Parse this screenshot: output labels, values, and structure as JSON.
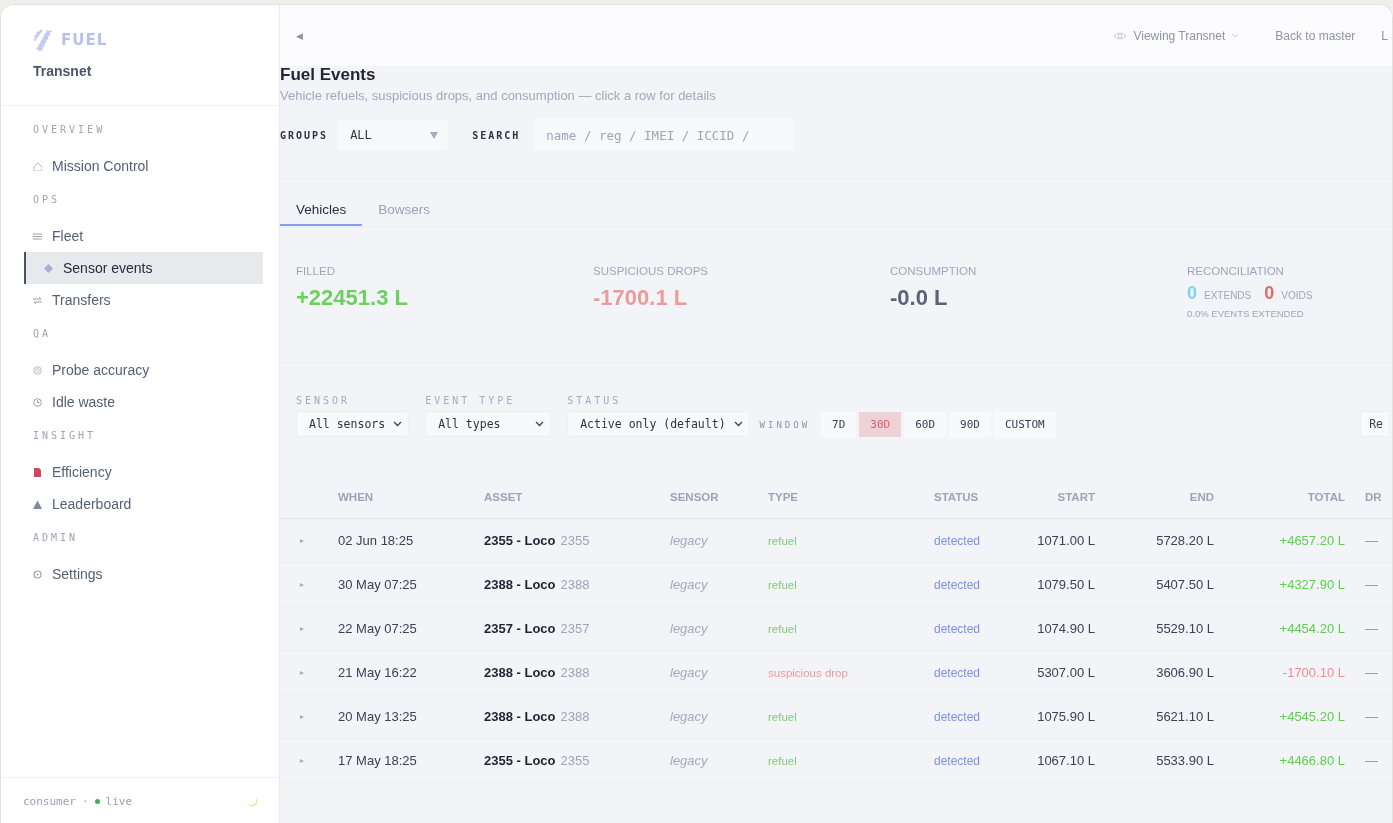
{
  "sidebar": {
    "logo": "FUEL",
    "org": "Transnet",
    "sections": [
      {
        "heading": "OVERVIEW",
        "items": [
          {
            "label": "Mission Control",
            "selected": false
          }
        ]
      },
      {
        "heading": "OPS",
        "items": [
          {
            "label": "Fleet",
            "selected": false
          },
          {
            "label": "Sensor events",
            "selected": true
          },
          {
            "label": "Transfers",
            "selected": false
          }
        ]
      },
      {
        "heading": "QA",
        "items": [
          {
            "label": "Probe accuracy",
            "selected": false
          },
          {
            "label": "Idle waste",
            "selected": false
          }
        ]
      },
      {
        "heading": "INSIGHT",
        "items": [
          {
            "label": "Efficiency",
            "selected": false
          },
          {
            "label": "Leaderboard",
            "selected": false
          }
        ]
      },
      {
        "heading": "ADMIN",
        "items": [
          {
            "label": "Settings",
            "selected": false
          }
        ]
      }
    ],
    "footer": {
      "role": "consumer",
      "separator": "·",
      "status": "live"
    }
  },
  "header": {
    "collapse": "◀",
    "viewing": "Viewing Transnet",
    "back": "Back to master",
    "cut_link": "L"
  },
  "page": {
    "title": "Fuel Events",
    "subtitle": "Vehicle refuels, suspicious drops, and consumption — click a row for details"
  },
  "filters": {
    "groups_label": "GROUPS",
    "groups_value": "ALL",
    "search_label": "SEARCH",
    "search_placeholder": "name / reg / IMEI / ICCID /"
  },
  "tabs": [
    {
      "label": "Vehicles",
      "selected": true
    },
    {
      "label": "Bowsers",
      "selected": false
    }
  ],
  "stats": [
    {
      "kind": "positive",
      "label": "FILLED",
      "value": "+22451.3 L"
    },
    {
      "kind": "negative",
      "label": "SUSPICIOUS DROPS",
      "value": "-1700.1 L"
    },
    {
      "kind": "neutral",
      "label": "CONSUMPTION",
      "value": "-0.0 L"
    },
    {
      "kind": "recon",
      "label": "RECONCILIATION",
      "extends": "0",
      "extends_label": "EXTENDS",
      "voids": "0",
      "voids_label": "VOIDS",
      "note": "0.0% EVENTS EXTENDED"
    }
  ],
  "controls": {
    "sensor_label": "SENSOR",
    "sensor": "All sensors",
    "type_label": "EVENT TYPE",
    "type": "All types",
    "status_label": "STATUS",
    "status": "Active only (default)",
    "window_label": "WINDOW",
    "windows": [
      {
        "label": "7D",
        "selected": false
      },
      {
        "label": "30D",
        "selected": true
      },
      {
        "label": "60D",
        "selected": false
      },
      {
        "label": "90D",
        "selected": false
      },
      {
        "label": "CUSTOM",
        "selected": false
      }
    ],
    "cut_button": "Re"
  },
  "table": {
    "columns": [
      "WHEN",
      "ASSET",
      "SENSOR",
      "TYPE",
      "STATUS",
      "START",
      "END",
      "TOTAL",
      "DR"
    ],
    "rows": [
      {
        "expander": "▸",
        "when": "02 Jun 18:25",
        "asset": "2355 - Loco",
        "asset_id": "2355",
        "sensor": "legacy",
        "kind": "refuel",
        "type": "refuel",
        "status": "detected",
        "start": "1071.00 L",
        "end": "5728.20 L",
        "total": "+4657.20 L",
        "dr": "—"
      },
      {
        "expander": "▸",
        "when": "30 May 07:25",
        "asset": "2388 - Loco",
        "asset_id": "2388",
        "sensor": "legacy",
        "kind": "refuel",
        "type": "refuel",
        "status": "detected",
        "start": "1079.50 L",
        "end": "5407.50 L",
        "total": "+4327.90 L",
        "dr": "—"
      },
      {
        "expander": "▸",
        "when": "22 May 07:25",
        "asset": "2357 - Loco",
        "asset_id": "2357",
        "sensor": "legacy",
        "kind": "refuel",
        "type": "refuel",
        "status": "detected",
        "start": "1074.90 L",
        "end": "5529.10 L",
        "total": "+4454.20 L",
        "dr": "—"
      },
      {
        "expander": "▸",
        "when": "21 May 16:22",
        "asset": "2388 - Loco",
        "asset_id": "2388",
        "sensor": "legacy",
        "kind": "drop",
        "type": "suspicious drop",
        "status": "detected",
        "start": "5307.00 L",
        "end": "3606.90 L",
        "total": "-1700.10 L",
        "dr": "—"
      },
      {
        "expander": "▸",
        "when": "20 May 13:25",
        "asset": "2388 - Loco",
        "asset_id": "2388",
        "sensor": "legacy",
        "kind": "refuel",
        "type": "refuel",
        "status": "detected",
        "start": "1075.90 L",
        "end": "5621.10 L",
        "total": "+4545.20 L",
        "dr": "—"
      },
      {
        "expander": "▸",
        "when": "17 May 18:25",
        "asset": "2355 - Loco",
        "asset_id": "2355",
        "sensor": "legacy",
        "kind": "refuel",
        "type": "refuel",
        "status": "detected",
        "start": "1067.10 L",
        "end": "5533.90 L",
        "total": "+4466.80 L",
        "dr": "—"
      }
    ]
  }
}
